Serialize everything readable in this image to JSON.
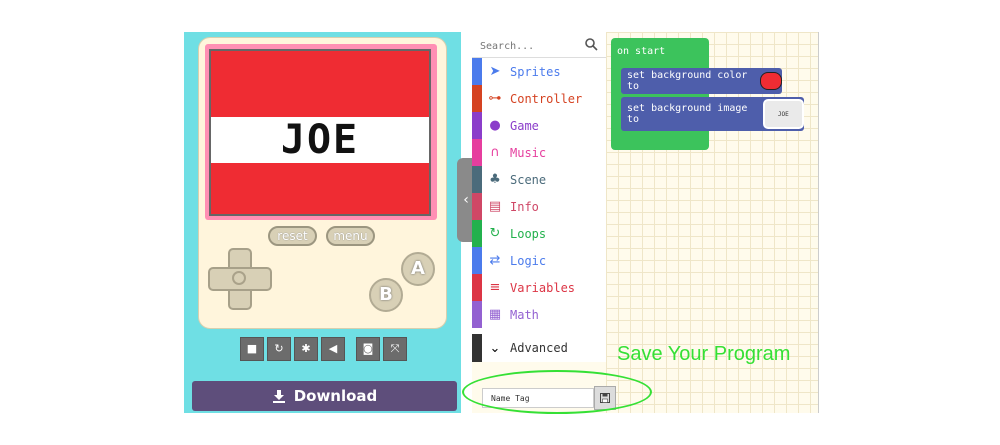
{
  "simulator": {
    "screen_text": "JOE",
    "reset_label": "reset",
    "menu_label": "menu",
    "a_label": "A",
    "b_label": "B",
    "background_color": "#ef2c33",
    "toolbar_icons": [
      "stop-icon",
      "restart-icon",
      "debug-icon",
      "mute-icon",
      "screenshot-icon",
      "fullscreen-icon"
    ],
    "download_label": "Download"
  },
  "toolbox": {
    "search_placeholder": "Search...",
    "categories": [
      {
        "label": "Sprites",
        "icon": "paper-plane-icon",
        "color": "#4b7bec"
      },
      {
        "label": "Controller",
        "icon": "gamepad-icon",
        "color": "#d54322"
      },
      {
        "label": "Game",
        "icon": "circle-icon",
        "color": "#8b3dca"
      },
      {
        "label": "Music",
        "icon": "headphones-icon",
        "color": "#e63e9e"
      },
      {
        "label": "Scene",
        "icon": "tree-icon",
        "color": "#4b6b7b"
      },
      {
        "label": "Info",
        "icon": "id-card-icon",
        "color": "#cf4766"
      },
      {
        "label": "Loops",
        "icon": "refresh-icon",
        "color": "#23b14d"
      },
      {
        "label": "Logic",
        "icon": "shuffle-icon",
        "color": "#4b7bec"
      },
      {
        "label": "Variables",
        "icon": "list-icon",
        "color": "#dc3545"
      },
      {
        "label": "Math",
        "icon": "calculator-icon",
        "color": "#9361d1"
      }
    ],
    "advanced_label": "Advanced"
  },
  "workspace": {
    "on_start_label": "on start",
    "block_color_label": "set background color to",
    "block_image_label": "set background image to",
    "image_thumb_text": "JOE",
    "save_caption": "Save Your Program"
  },
  "save_bar": {
    "project_name": "Name Tag"
  }
}
